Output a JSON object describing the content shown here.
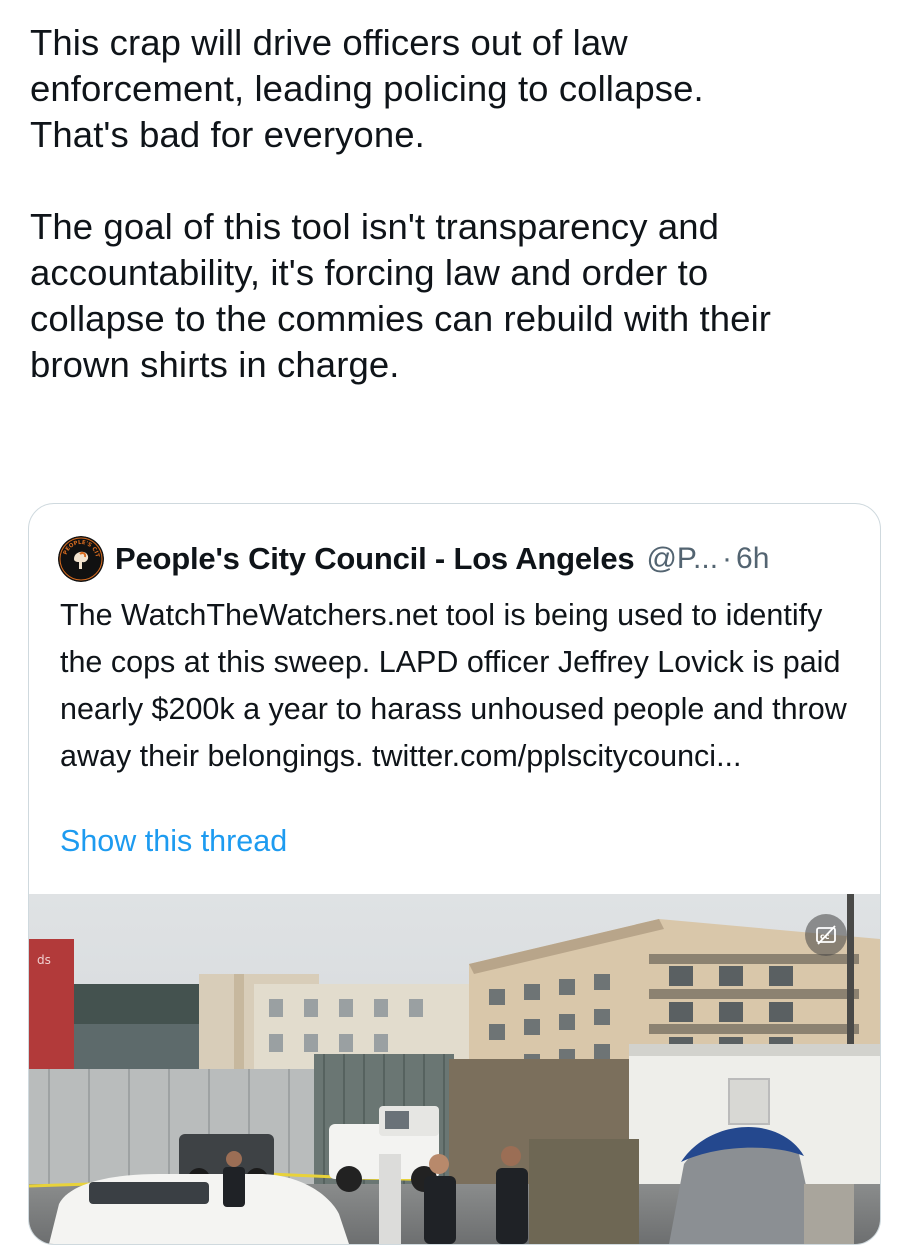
{
  "tweet": {
    "text": "This crap will drive officers out of law\nenforcement, leading policing to collapse.\nThat's bad for everyone.\n\nThe goal of this tool isn't transparency and\naccountability, it's forcing law and order to\ncollapse to the commies can rebuild with their\nbrown shirts in charge."
  },
  "quoted_tweet": {
    "avatar_icon": "peoples-city-council-logo-icon",
    "avatar_text": "PEOPLE'S CITY COUNCIL · LOS ANGELES",
    "display_name": "People's City Council - Los Angeles",
    "handle": "@P...",
    "separator": "·",
    "time": "6h",
    "text": "The WatchTheWatchers.net tool is being used to identify the cops at this sweep. LAPD officer Jeffrey Lovick is paid nearly $200k a year to harass unhoused people and throw away their belongings. twitter.com/pplscitycounci...",
    "show_thread_label": "Show this thread",
    "link_color": "#1d9bf0",
    "media": {
      "captions_icon": "closed-captions-off-icon",
      "sign_text": "ds"
    }
  }
}
